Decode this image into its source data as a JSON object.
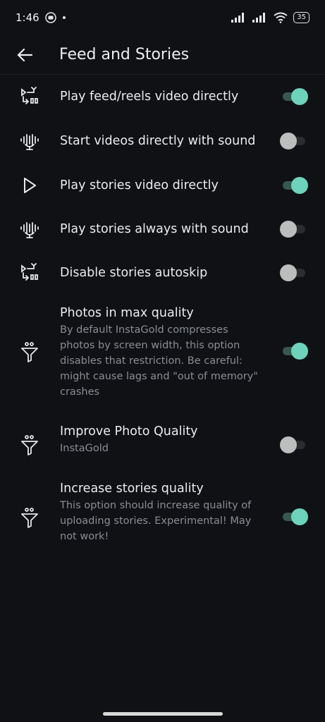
{
  "status_bar": {
    "time": "1:46",
    "battery": "35"
  },
  "app_bar": {
    "title": "Feed and Stories"
  },
  "settings": [
    {
      "label": "Play feed/reels video directly",
      "description": "",
      "icon": "video-swap-icon",
      "enabled": true
    },
    {
      "label": "Start videos directly with sound",
      "description": "",
      "icon": "voice-mic-icon",
      "enabled": false
    },
    {
      "label": "Play stories video directly",
      "description": "",
      "icon": "play-icon",
      "enabled": true
    },
    {
      "label": "Play stories always with sound",
      "description": "",
      "icon": "voice-mic-icon",
      "enabled": false
    },
    {
      "label": "Disable stories autoskip",
      "description": "",
      "icon": "video-swap-icon",
      "enabled": false
    },
    {
      "label": "Photos in max quality",
      "description": "By default InstaGold  compresses photos by screen width, this option disables that restriction. Be careful: might cause lags and \"out of memory\" crashes",
      "icon": "filter-icon",
      "enabled": true
    },
    {
      "label": "Improve Photo Quality",
      "description": "InstaGold",
      "icon": "filter-icon",
      "enabled": false
    },
    {
      "label": "Increase stories quality",
      "description": "This option should increase quality of uploading stories. Experimental! May not work!",
      "icon": "filter-icon",
      "enabled": true
    }
  ]
}
